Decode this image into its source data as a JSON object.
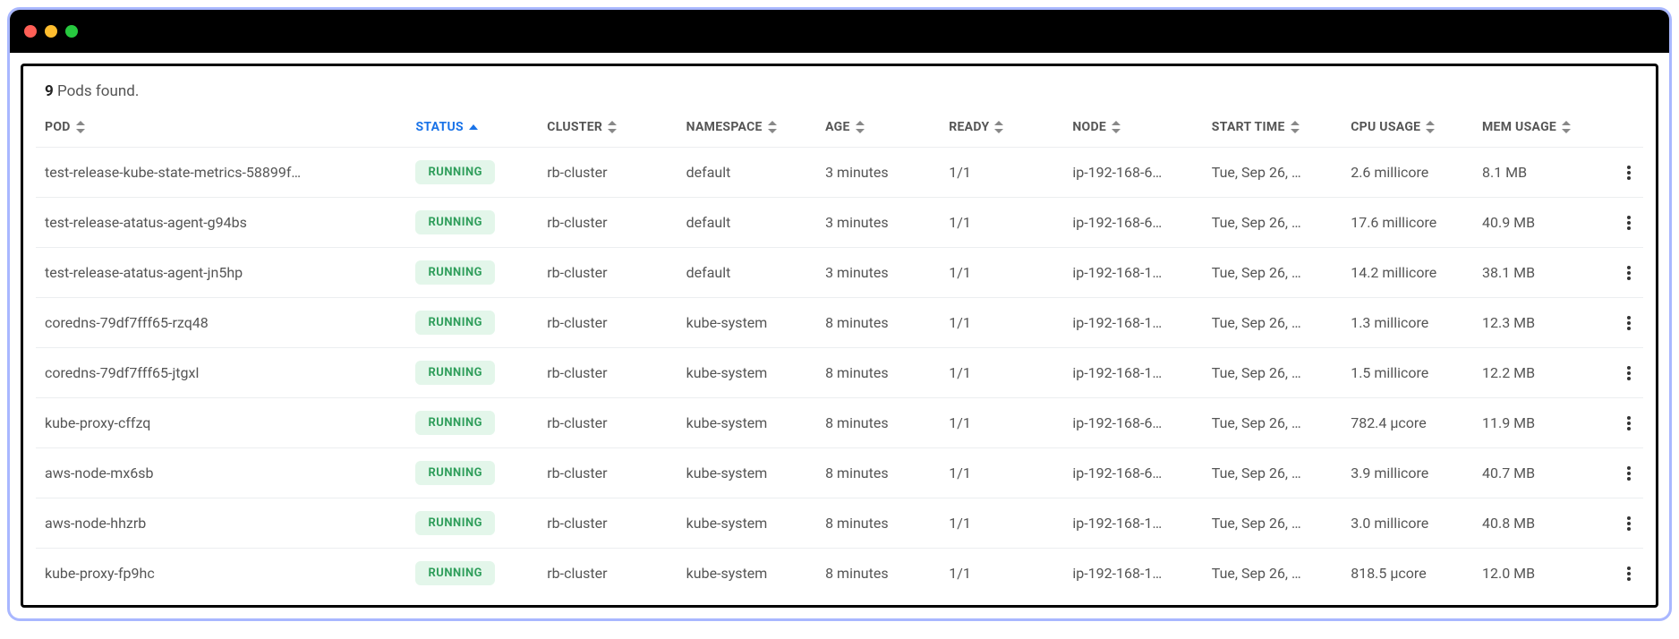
{
  "summary": {
    "count": "9",
    "label": "Pods found."
  },
  "columns": {
    "pod": "POD",
    "status": "STATUS",
    "cluster": "CLUSTER",
    "namespace": "NAMESPACE",
    "age": "AGE",
    "ready": "READY",
    "node": "NODE",
    "start_time": "START TIME",
    "cpu": "CPU USAGE",
    "mem": "MEM USAGE"
  },
  "rows": [
    {
      "pod": "test-release-kube-state-metrics-58899f…",
      "status": "RUNNING",
      "cluster": "rb-cluster",
      "namespace": "default",
      "age": "3 minutes",
      "ready": "1/1",
      "node": "ip-192-168-6…",
      "start_time": "Tue, Sep 26, …",
      "cpu": "2.6 millicore",
      "mem": "8.1 MB"
    },
    {
      "pod": "test-release-atatus-agent-g94bs",
      "status": "RUNNING",
      "cluster": "rb-cluster",
      "namespace": "default",
      "age": "3 minutes",
      "ready": "1/1",
      "node": "ip-192-168-6…",
      "start_time": "Tue, Sep 26, …",
      "cpu": "17.6 millicore",
      "mem": "40.9 MB"
    },
    {
      "pod": "test-release-atatus-agent-jn5hp",
      "status": "RUNNING",
      "cluster": "rb-cluster",
      "namespace": "default",
      "age": "3 minutes",
      "ready": "1/1",
      "node": "ip-192-168-1…",
      "start_time": "Tue, Sep 26, …",
      "cpu": "14.2 millicore",
      "mem": "38.1 MB"
    },
    {
      "pod": "coredns-79df7fff65-rzq48",
      "status": "RUNNING",
      "cluster": "rb-cluster",
      "namespace": "kube-system",
      "age": "8 minutes",
      "ready": "1/1",
      "node": "ip-192-168-1…",
      "start_time": "Tue, Sep 26, …",
      "cpu": "1.3 millicore",
      "mem": "12.3 MB"
    },
    {
      "pod": "coredns-79df7fff65-jtgxl",
      "status": "RUNNING",
      "cluster": "rb-cluster",
      "namespace": "kube-system",
      "age": "8 minutes",
      "ready": "1/1",
      "node": "ip-192-168-1…",
      "start_time": "Tue, Sep 26, …",
      "cpu": "1.5 millicore",
      "mem": "12.2 MB"
    },
    {
      "pod": "kube-proxy-cffzq",
      "status": "RUNNING",
      "cluster": "rb-cluster",
      "namespace": "kube-system",
      "age": "8 minutes",
      "ready": "1/1",
      "node": "ip-192-168-6…",
      "start_time": "Tue, Sep 26, …",
      "cpu": "782.4 µcore",
      "mem": "11.9 MB"
    },
    {
      "pod": "aws-node-mx6sb",
      "status": "RUNNING",
      "cluster": "rb-cluster",
      "namespace": "kube-system",
      "age": "8 minutes",
      "ready": "1/1",
      "node": "ip-192-168-6…",
      "start_time": "Tue, Sep 26, …",
      "cpu": "3.9 millicore",
      "mem": "40.7 MB"
    },
    {
      "pod": "aws-node-hhzrb",
      "status": "RUNNING",
      "cluster": "rb-cluster",
      "namespace": "kube-system",
      "age": "8 minutes",
      "ready": "1/1",
      "node": "ip-192-168-1…",
      "start_time": "Tue, Sep 26, …",
      "cpu": "3.0 millicore",
      "mem": "40.8 MB"
    },
    {
      "pod": "kube-proxy-fp9hc",
      "status": "RUNNING",
      "cluster": "rb-cluster",
      "namespace": "kube-system",
      "age": "8 minutes",
      "ready": "1/1",
      "node": "ip-192-168-1…",
      "start_time": "Tue, Sep 26, …",
      "cpu": "818.5 µcore",
      "mem": "12.0 MB"
    }
  ]
}
